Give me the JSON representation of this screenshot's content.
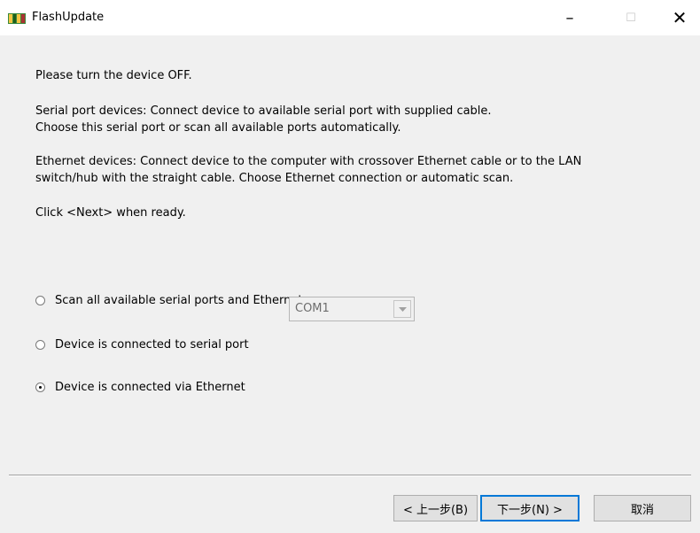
{
  "window": {
    "title": "FlashUpdate",
    "minimize_symbol": "–",
    "maximize_symbol": "☐",
    "close_symbol": "✕"
  },
  "instructions": {
    "line1": "Please turn the device OFF.",
    "serial_line1": "Serial port devices: Connect device to available serial port with supplied cable.",
    "serial_line2": "Choose this serial port or scan all available ports automatically.",
    "ethernet_line1": "Ethernet devices: Connect device to the computer with crossover Ethernet cable or to the LAN",
    "ethernet_line2": "switch/hub with the straight cable. Choose Ethernet connection or automatic scan.",
    "click_next": "Click <Next> when ready."
  },
  "options": {
    "scan_all": {
      "label": "Scan all available serial ports and Ethernet",
      "checked": false
    },
    "serial_port": {
      "label": "Device is connected to serial port",
      "checked": false
    },
    "ethernet": {
      "label": "Device is connected via Ethernet",
      "checked": true
    }
  },
  "serial_port_select": {
    "selected": "COM1",
    "disabled": true
  },
  "buttons": {
    "back": "< 上一步(B)",
    "next": "下一步(N) >",
    "cancel": "取消"
  },
  "colors": {
    "dialog_bg": "#f0f0f0",
    "titlebar_bg": "#ffffff",
    "default_button_border": "#0078d7"
  }
}
